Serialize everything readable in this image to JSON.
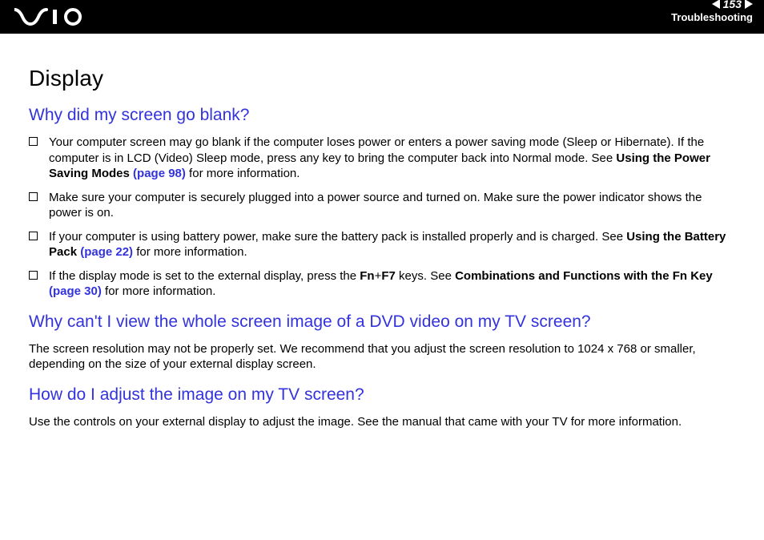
{
  "header": {
    "page_number": "153",
    "section": "Troubleshooting"
  },
  "content": {
    "title": "Display",
    "q1": {
      "heading": "Why did my screen go blank?",
      "items": {
        "i1": {
          "t1": "Your computer screen may go blank if the computer loses power or enters a power saving mode (Sleep or Hibernate). If the computer is in LCD (Video) Sleep mode, press any key to bring the computer back into Normal mode. See ",
          "b1": "Using the Power Saving Modes ",
          "l1": "(page 98)",
          "t2": " for more information."
        },
        "i2": {
          "t1": "Make sure your computer is securely plugged into a power source and turned on. Make sure the power indicator shows the power is on."
        },
        "i3": {
          "t1": "If your computer is using battery power, make sure the battery pack is installed properly and is charged. See ",
          "b1": "Using the Battery Pack ",
          "l1": "(page 22)",
          "t2": " for more information."
        },
        "i4": {
          "t1": "If the display mode is set to the external display, press the ",
          "b1": "Fn",
          "t2": "+",
          "b2": "F7",
          "t3": " keys. See ",
          "b3": "Combinations and Functions with the Fn Key ",
          "l1": "(page 30)",
          "t4": " for more information."
        }
      }
    },
    "q2": {
      "heading": "Why can't I view the whole screen image of a DVD video on my TV screen?",
      "para": "The screen resolution may not be properly set. We recommend that you adjust the screen resolution to 1024 x 768 or smaller, depending on the size of your external display screen."
    },
    "q3": {
      "heading": "How do I adjust the image on my TV screen?",
      "para": "Use the controls on your external display to adjust the image. See the manual that came with your TV for more information."
    }
  }
}
